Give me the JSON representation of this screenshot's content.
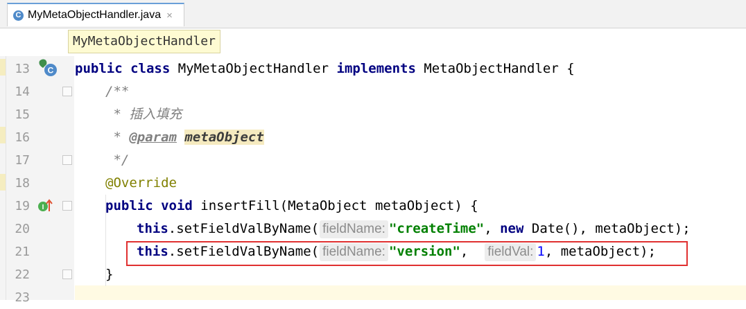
{
  "tab": {
    "icon": "C",
    "label": "MyMetaObjectHandler.java",
    "close": "×"
  },
  "breadcrumb": "MyMetaObjectHandler",
  "line_numbers": [
    "13",
    "14",
    "15",
    "16",
    "17",
    "18",
    "19",
    "20",
    "21",
    "22",
    "23"
  ],
  "code": {
    "l13": {
      "kw1": "public class",
      "name": " MyMetaObjectHandler ",
      "kw2": "implements",
      "rest": " MetaObjectHandler {"
    },
    "l14": "/**",
    "l15": " * 插入填充",
    "l16": {
      "star": " * ",
      "tag": "@param",
      "param": "metaObject"
    },
    "l17": " */",
    "l18": "@Override",
    "l19": {
      "kw": "public void",
      "rest": " insertFill(MetaObject metaObject) {"
    },
    "l20": {
      "kw": "this",
      "call": ".setFieldValByName(",
      "hint": "fieldName:",
      "str": "\"createTime\"",
      "sep": ", ",
      "kw2": "new",
      "rest": " Date(), metaObject);"
    },
    "l21": {
      "kw": "this",
      "call": ".setFieldValByName(",
      "hint1": "fieldName:",
      "str": "\"version\"",
      "sep": ",  ",
      "hint2": "fieldVal:",
      "num": "1",
      "rest": ", metaObject);"
    },
    "l22": "}"
  },
  "icons": {
    "class_marker": "class-implements-icon",
    "impl_marker": "implementing-method-icon",
    "tab_icon": "java-class-icon"
  },
  "colors": {
    "keyword": "#000080",
    "string": "#008000",
    "annotation": "#808000",
    "comment": "#808080",
    "number": "#0000ff",
    "highlight_box": "#e03030"
  }
}
